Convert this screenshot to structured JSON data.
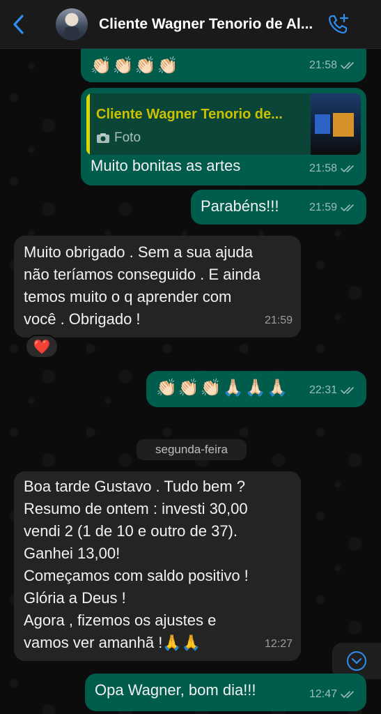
{
  "header": {
    "contact_name": "Cliente Wagner Tenorio de Al...",
    "accent_color": "#2f8ff0"
  },
  "messages": [
    {
      "direction": "out",
      "text": "👏🏻👏🏻👏🏻👏🏻",
      "time": "21:58",
      "status": "read"
    },
    {
      "direction": "out",
      "quote_name": "Cliente Wagner Tenorio de...",
      "quote_type": "Foto",
      "text": "Muito bonitas as artes",
      "time": "21:58",
      "status": "read"
    },
    {
      "direction": "out",
      "text": "Parabéns!!!",
      "time": "21:59",
      "status": "read"
    },
    {
      "direction": "in",
      "lines": [
        "Muito obrigado . Sem a sua ajuda",
        "não teríamos conseguido . E ainda",
        "temos muito o q aprender com",
        "você . Obrigado !"
      ],
      "time": "21:59",
      "reaction": "❤️"
    },
    {
      "direction": "out",
      "text": "👏🏻👏🏻👏🏻🙏🏻🙏🏻🙏🏻",
      "time": "22:31",
      "status": "read"
    },
    {
      "direction": "in",
      "lines": [
        "Boa tarde Gustavo . Tudo bem ?",
        "Resumo de ontem : investi 30,00",
        "vendi 2 (1 de 10 e outro de 37).",
        "Ganhei 13,00!",
        "Começamos com saldo positivo !",
        "Glória a Deus !",
        "Agora , fizemos os ajustes e",
        "vamos ver amanhã !🙏🙏"
      ],
      "time": "12:27"
    },
    {
      "direction": "out",
      "text": "Opa Wagner, bom dia!!!",
      "time": "12:47",
      "status": "read"
    }
  ],
  "date_separator": "segunda-feira",
  "icons": {
    "back": "chevron-left-icon",
    "call": "phone-plus-icon",
    "camera": "camera-icon",
    "ticks": "double-check-icon",
    "scroll": "chevron-down-icon"
  }
}
